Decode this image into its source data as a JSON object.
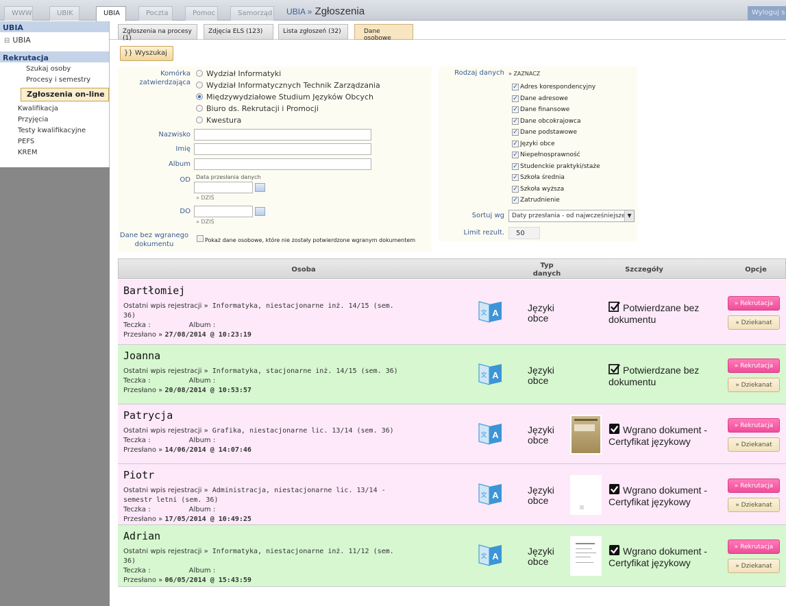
{
  "topbar": {
    "tabs": [
      "WWW",
      "UBIK",
      "UBIA",
      "Poczta",
      "Pomoc",
      "Samorząd"
    ],
    "active_tab": "UBIA",
    "breadcrumb_prefix": "UBIA »",
    "title": "Zgłoszenia",
    "logout_label": "Wyloguj s"
  },
  "sidebar": {
    "header": "UBIA",
    "sub": "UBIA",
    "section": "Rekrutacja",
    "items": [
      "Szukaj osoby",
      "Procesy i semestry",
      "Zgłoszenia on-line",
      "Kwalifikacja",
      "Przyjęcia",
      "Testy kwalifikacyjne",
      "PEFS",
      "KREM"
    ],
    "active_item": "Zgłoszenia on-line"
  },
  "content_tabs": [
    "Zgłoszenia na procesy (1)",
    "Zdjęcia ELS (123)",
    "Lista zgłoszeń (32)",
    "Dane osobowe"
  ],
  "active_content_tab": "Dane osobowe",
  "search_button": "}} Wyszukaj",
  "form": {
    "komorka_label": "Komórka zatwierdzająca",
    "units": [
      "Wydział Informatyki",
      "Wydział Informatycznych Technik Zarządzania",
      "Międzywydziałowe Studium Języków Obcych",
      "Biuro ds. Rekrutacji i Promocji",
      "Kwestura"
    ],
    "selected_unit": "Międzywydziałowe Studium Języków Obcych",
    "nazwisko_label": "Nazwisko",
    "imie_label": "Imię",
    "album_label": "Album",
    "od_label": "OD",
    "date_caption": "Data przesłania danych",
    "dzis": "» DZIŚ",
    "do_label": "DO",
    "bez_label": "Dane bez wgranego dokumentu",
    "bez_checkbox": "Pokaż dane osobowe, które nie zostały potwierdzone wgranym dokumentem",
    "rodzaj_label": "Rodzaj danych",
    "zaznacz": "» ZAZNACZ",
    "data_types": [
      "Adres korespondencyjny",
      "Dane adresowe",
      "Dane finansowe",
      "Dane obcokrajowca",
      "Dane podstawowe",
      "Języki obce",
      "Niepełnosprawność",
      "Studenckie praktyki/staże",
      "Szkoła średnia",
      "Szkoła wyższa",
      "Zatrudnienie"
    ],
    "sort_label": "Sortuj wg",
    "sort_value": "Daty przesłania - od najwcześniejszej",
    "limit_label": "Limit rezult.",
    "limit_value": "50"
  },
  "table": {
    "headers": {
      "osoba": "Osoba",
      "typ_1": "Typ",
      "typ_2": "danych",
      "szczegoly": "Szczegóły",
      "opcje": "Opcje"
    },
    "teczka": "Teczka :",
    "album": "Album :",
    "sent_prefix": "Przesłano »",
    "btn_rek": "» Rekrutacja",
    "btn_dzi": "» Dziekanat",
    "rows": [
      {
        "name": "Bartłomiej",
        "wpis_prefix": "Ostatni wpis rejestracji »",
        "wpis_1": " Informatyka, niestacjonarne inż. 14/15 (sem.",
        "wpis_2": "36)",
        "sent": "27/08/2014 @ 10:23:19",
        "type_1": "Języki",
        "type_2": "obce",
        "detail_1": "Potwierdzane bez",
        "detail_2": "dokumentu",
        "color": "#fde9fa"
      },
      {
        "name": "Joanna",
        "wpis_prefix": "Ostatni wpis rejestracji »",
        "wpis_1": " Informatyka, stacjonarne inż. 14/15 (sem. 36)",
        "wpis_2": "",
        "sent": "20/08/2014 @ 10:53:57",
        "type_1": "Języki",
        "type_2": "obce",
        "detail_1": "Potwierdzane bez",
        "detail_2": "dokumentu",
        "color": "#d6f7cf"
      },
      {
        "name": "Patrycja",
        "wpis_prefix": "Ostatni wpis rejestracji »",
        "wpis_1": " Grafika, niestacjonarne lic. 13/14 (sem. 36)",
        "wpis_2": "",
        "sent": "14/06/2014 @ 14:07:46",
        "type_1": "Języki",
        "type_2": "obce",
        "detail_1": "Wgrano dokument -",
        "detail_2": "Certyfikat językowy",
        "color": "#fde9fa"
      },
      {
        "name": "Piotr",
        "wpis_prefix": "Ostatni wpis rejestracji »",
        "wpis_1": " Administracja, niestacjonarne lic. 13/14 -",
        "wpis_2": "semestr letni (sem. 36)",
        "sent": "17/05/2014 @ 10:49:25",
        "type_1": "Języki",
        "type_2": "obce",
        "detail_1": "Wgrano dokument -",
        "detail_2": "Certyfikat językowy",
        "color": "#fde9fa"
      },
      {
        "name": "Adrian",
        "wpis_prefix": "Ostatni wpis rejestracji »",
        "wpis_1": " Informatyka, niestacjonarne inż. 11/12 (sem.",
        "wpis_2": "36)",
        "sent": "06/05/2014 @ 15:43:59",
        "type_1": "Języki",
        "type_2": "obce",
        "detail_1": "Wgrano dokument -",
        "detail_2": "Certyfikat językowy",
        "color": "#d6f7cf"
      }
    ]
  }
}
